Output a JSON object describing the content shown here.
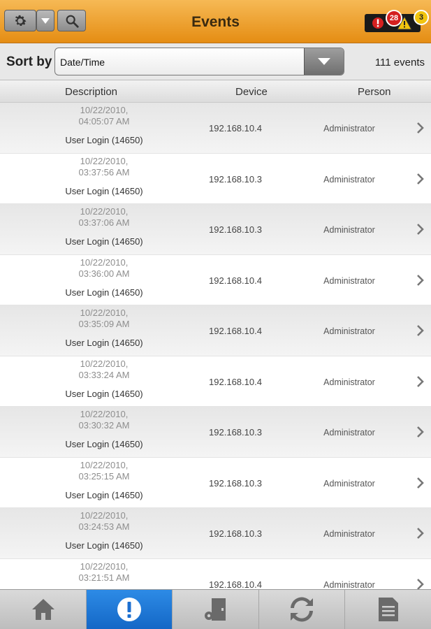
{
  "header": {
    "title": "Events",
    "alerts_count": "28",
    "warnings_count": "3"
  },
  "sortbar": {
    "label": "Sort by",
    "selected": "Date/Time",
    "event_count": "111 events"
  },
  "columns": {
    "description": "Description",
    "device": "Device",
    "person": "Person"
  },
  "events": [
    {
      "date": "10/22/2010,",
      "time": "04:05:07 AM",
      "description": "User Login (14650)",
      "device": "192.168.10.4",
      "person": "Administrator"
    },
    {
      "date": "10/22/2010,",
      "time": "03:37:56 AM",
      "description": "User Login (14650)",
      "device": "192.168.10.3",
      "person": "Administrator"
    },
    {
      "date": "10/22/2010,",
      "time": "03:37:06 AM",
      "description": "User Login (14650)",
      "device": "192.168.10.3",
      "person": "Administrator"
    },
    {
      "date": "10/22/2010,",
      "time": "03:36:00 AM",
      "description": "User Login (14650)",
      "device": "192.168.10.4",
      "person": "Administrator"
    },
    {
      "date": "10/22/2010,",
      "time": "03:35:09 AM",
      "description": "User Login (14650)",
      "device": "192.168.10.4",
      "person": "Administrator"
    },
    {
      "date": "10/22/2010,",
      "time": "03:33:24 AM",
      "description": "User Login (14650)",
      "device": "192.168.10.4",
      "person": "Administrator"
    },
    {
      "date": "10/22/2010,",
      "time": "03:30:32 AM",
      "description": "User Login (14650)",
      "device": "192.168.10.3",
      "person": "Administrator"
    },
    {
      "date": "10/22/2010,",
      "time": "03:25:15 AM",
      "description": "User Login (14650)",
      "device": "192.168.10.3",
      "person": "Administrator"
    },
    {
      "date": "10/22/2010,",
      "time": "03:24:53 AM",
      "description": "User Login (14650)",
      "device": "192.168.10.3",
      "person": "Administrator"
    },
    {
      "date": "10/22/2010,",
      "time": "03:21:51 AM",
      "description": "",
      "device": "192.168.10.4",
      "person": "Administrator"
    }
  ],
  "tabs": [
    {
      "icon": "home-icon",
      "active": false
    },
    {
      "icon": "alert-icon",
      "active": true
    },
    {
      "icon": "door-settings-icon",
      "active": false
    },
    {
      "icon": "sync-icon",
      "active": false
    },
    {
      "icon": "document-icon",
      "active": false
    }
  ],
  "colors": {
    "header": "#e58d13",
    "active_tab": "#1c77d6"
  }
}
